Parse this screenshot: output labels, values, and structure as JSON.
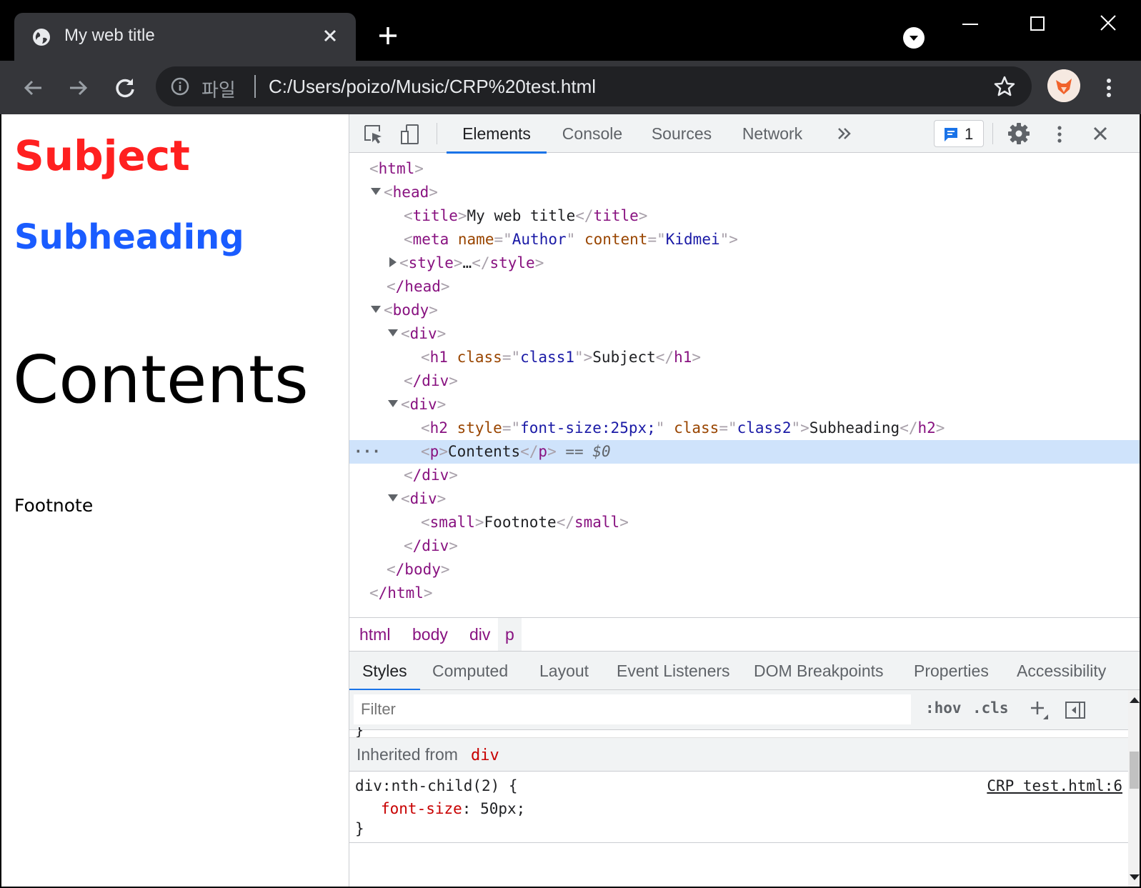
{
  "browser": {
    "tab_title": "My web title",
    "omnibox": {
      "scheme_label": "파일",
      "url": "C:/Users/poizo/Music/CRP%20test.html"
    }
  },
  "page": {
    "h1": "Subject",
    "h2": "Subheading",
    "p": "Contents",
    "small": "Footnote",
    "h1_color": "#ff2020",
    "h2_color": "#1a5cff"
  },
  "devtools": {
    "tabs": [
      "Elements",
      "Console",
      "Sources",
      "Network"
    ],
    "active_tab": "Elements",
    "issues_count": "1",
    "dom": {
      "l1_tag": "html",
      "l2_tag": "head",
      "l3_tag": "title",
      "l3_text": "My web title",
      "l4_tag": "meta",
      "l4_attr1": "name",
      "l4_val1": "Author",
      "l4_attr2": "content",
      "l4_val2": "Kidmei",
      "l5_tag": "style",
      "l5_ellipsis": "…",
      "l6_tag": "/head",
      "l7_tag": "body",
      "l8_tag": "div",
      "l9_tag": "h1",
      "l9_attr": "class",
      "l9_val": "class1",
      "l9_text": "Subject",
      "l10_tag": "/div",
      "l11_tag": "div",
      "l12_tag": "h2",
      "l12_attr1": "style",
      "l12_val1": "font-size:25px;",
      "l12_attr2": "class",
      "l12_val2": "class2",
      "l12_text": "Subheading",
      "l13_tag": "p",
      "l13_text": "Contents",
      "l13_eq": "==",
      "l13_ref": "$0",
      "l14_tag": "/div",
      "l15_tag": "div",
      "l16_tag": "small",
      "l16_text": "Footnote",
      "l17_tag": "/div",
      "l18_tag": "/body",
      "l19_tag": "/html"
    },
    "breadcrumbs": [
      "html",
      "body",
      "div",
      "p"
    ],
    "lower_tabs": [
      "Styles",
      "Computed",
      "Layout",
      "Event Listeners",
      "DOM Breakpoints",
      "Properties",
      "Accessibility"
    ],
    "styles": {
      "filter_placeholder": "Filter",
      "hov": ":hov",
      "cls": ".cls",
      "inherited_label": "Inherited from",
      "inherited_tag": "div",
      "rule_selector": "div:nth-child(2) {",
      "rule_source": "CRP test.html:6",
      "prop_name": "font-size",
      "prop_value": "50px;",
      "rule_close": "}"
    }
  }
}
